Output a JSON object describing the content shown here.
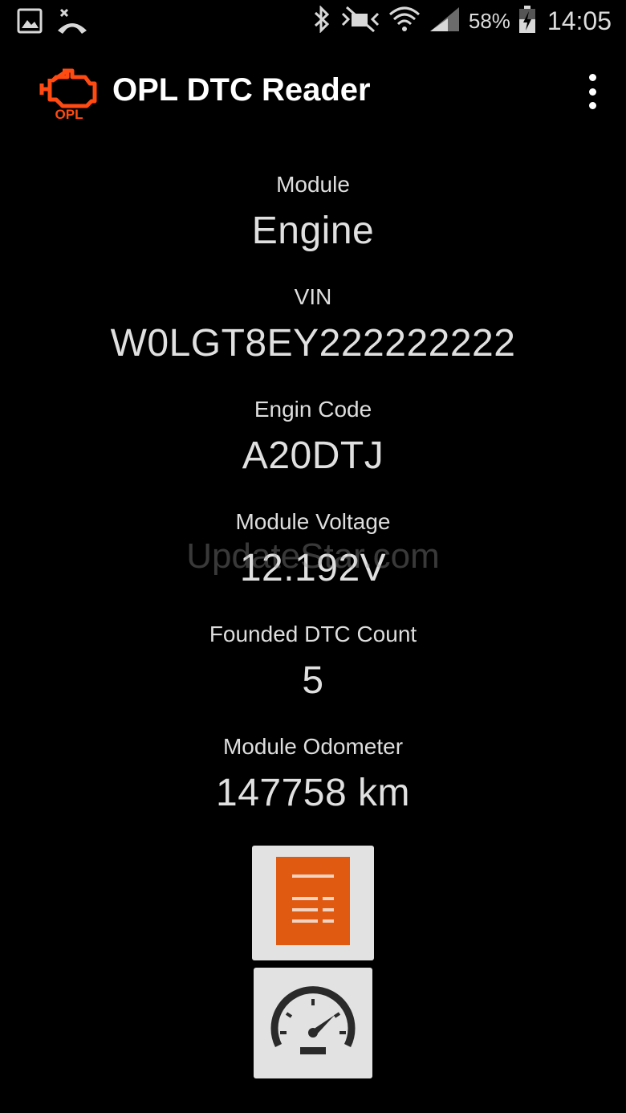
{
  "status_bar": {
    "battery_percent": "58%",
    "time": "14:05",
    "icons": [
      "image-icon",
      "missed-call-icon",
      "bluetooth-icon",
      "mute-icon",
      "wifi-icon",
      "signal-icon",
      "battery-icon"
    ]
  },
  "app": {
    "title": "OPL DTC Reader",
    "logo_text": "OPL",
    "logo_color": "#ff4a12"
  },
  "info": {
    "module": {
      "label": "Module",
      "value": "Engine"
    },
    "vin": {
      "label": "VIN",
      "value": "W0LGT8EY222222222"
    },
    "engine_code": {
      "label": "Engin Code",
      "value": "A20DTJ"
    },
    "voltage": {
      "label": "Module Voltage",
      "value": "12.192V"
    },
    "dtc_count": {
      "label": "Founded DTC Count",
      "value": "5"
    },
    "odometer": {
      "label": "Module Odometer",
      "value": "147758 km"
    }
  },
  "watermark": "UpdateStar.com",
  "buttons": {
    "dtc_list_icon": "document-list-icon",
    "gauge_icon": "speedometer-icon",
    "accent": "#e05a12"
  }
}
